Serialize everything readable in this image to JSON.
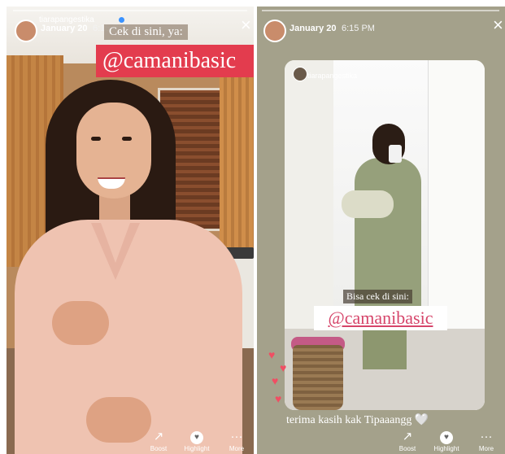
{
  "left_story": {
    "username": "tiarapangestika",
    "date": "January 20",
    "time": "6:15 PM",
    "sticker_label": "Cek di sini, ya:",
    "mention": "@camanibasic",
    "close_icon": "×",
    "actions": [
      {
        "label": "Boost",
        "icon": "↗"
      },
      {
        "label": "Highlight",
        "icon": "♥"
      },
      {
        "label": "More",
        "icon": "···"
      }
    ]
  },
  "right_story": {
    "date": "January 20",
    "time": "6:15 PM",
    "close_icon": "×",
    "embedded_username": "tiarapangestika",
    "embedded_label": "Bisa cek di sini:",
    "mention": "@camanibasic",
    "caption": "terima kasih kak Tipaaangg 🤍",
    "actions": [
      {
        "label": "Boost",
        "icon": "↗"
      },
      {
        "label": "Highlight",
        "icon": "♥"
      },
      {
        "label": "More",
        "icon": "···"
      }
    ]
  },
  "colors": {
    "mention_bg_left": "#e33c4e",
    "mention_text_right": "#d6456a",
    "verified": "#3a92ff",
    "heart": "#f04e63"
  }
}
